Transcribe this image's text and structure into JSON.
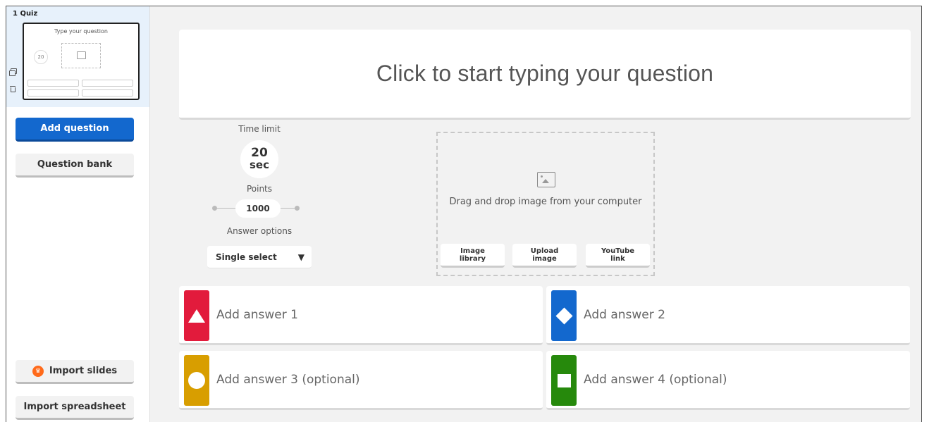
{
  "sidebar": {
    "slide_title": "1  Quiz",
    "thumbnail": {
      "question": "Type your question",
      "time": "20"
    },
    "tools": [
      {
        "icon": "duplicate-icon"
      },
      {
        "icon": "trash-icon"
      }
    ],
    "add_question_label": "Add question",
    "question_bank_label": "Question bank",
    "import_slides_label": "Import slides",
    "import_spreadsheet_label": "Import spreadsheet"
  },
  "question": {
    "placeholder": "Click to start typing your question"
  },
  "settings": {
    "time_limit_label": "Time limit",
    "time_value": "20",
    "time_unit": "sec",
    "points_label": "Points",
    "points_value": "1000",
    "answer_options_label": "Answer options",
    "answer_options_value": "Single select",
    "answer_options_arrow": "▼"
  },
  "media": {
    "icon": "image-icon",
    "drop_text": "Drag and drop image from your computer",
    "buttons": [
      {
        "line1": "Image",
        "line2": "library"
      },
      {
        "line1": "Upload",
        "line2": "image"
      },
      {
        "line1": "YouTube",
        "line2": "link"
      }
    ]
  },
  "answers": [
    {
      "label": "Add answer 1",
      "color": "#e21b3c",
      "shape": "triangle"
    },
    {
      "label": "Add answer 2",
      "color": "#1368ce",
      "shape": "diamond"
    },
    {
      "label": "Add answer 3 (optional)",
      "color": "#d89e00",
      "shape": "circle"
    },
    {
      "label": "Add answer 4 (optional)",
      "color": "#26890c",
      "shape": "square"
    }
  ]
}
